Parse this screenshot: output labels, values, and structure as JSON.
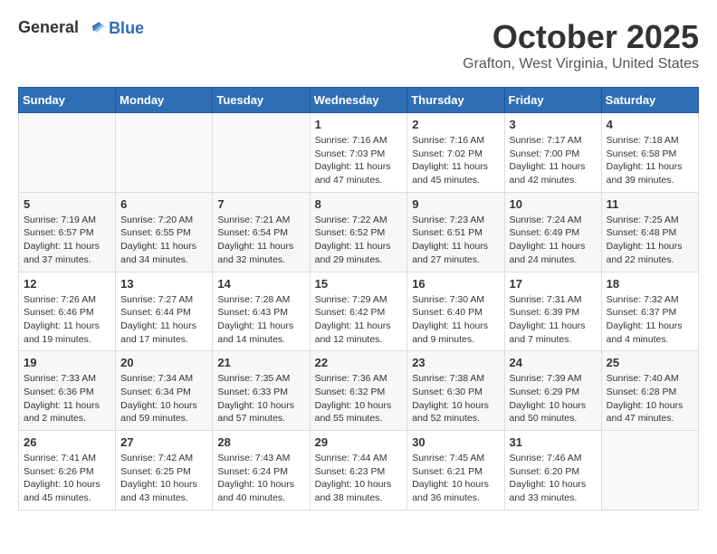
{
  "header": {
    "logo_line1": "General",
    "logo_line2": "Blue",
    "month_title": "October 2025",
    "location": "Grafton, West Virginia, United States"
  },
  "days_of_week": [
    "Sunday",
    "Monday",
    "Tuesday",
    "Wednesday",
    "Thursday",
    "Friday",
    "Saturday"
  ],
  "weeks": [
    [
      {
        "day": "",
        "info": ""
      },
      {
        "day": "",
        "info": ""
      },
      {
        "day": "",
        "info": ""
      },
      {
        "day": "1",
        "info": "Sunrise: 7:16 AM\nSunset: 7:03 PM\nDaylight: 11 hours and 47 minutes."
      },
      {
        "day": "2",
        "info": "Sunrise: 7:16 AM\nSunset: 7:02 PM\nDaylight: 11 hours and 45 minutes."
      },
      {
        "day": "3",
        "info": "Sunrise: 7:17 AM\nSunset: 7:00 PM\nDaylight: 11 hours and 42 minutes."
      },
      {
        "day": "4",
        "info": "Sunrise: 7:18 AM\nSunset: 6:58 PM\nDaylight: 11 hours and 39 minutes."
      }
    ],
    [
      {
        "day": "5",
        "info": "Sunrise: 7:19 AM\nSunset: 6:57 PM\nDaylight: 11 hours and 37 minutes."
      },
      {
        "day": "6",
        "info": "Sunrise: 7:20 AM\nSunset: 6:55 PM\nDaylight: 11 hours and 34 minutes."
      },
      {
        "day": "7",
        "info": "Sunrise: 7:21 AM\nSunset: 6:54 PM\nDaylight: 11 hours and 32 minutes."
      },
      {
        "day": "8",
        "info": "Sunrise: 7:22 AM\nSunset: 6:52 PM\nDaylight: 11 hours and 29 minutes."
      },
      {
        "day": "9",
        "info": "Sunrise: 7:23 AM\nSunset: 6:51 PM\nDaylight: 11 hours and 27 minutes."
      },
      {
        "day": "10",
        "info": "Sunrise: 7:24 AM\nSunset: 6:49 PM\nDaylight: 11 hours and 24 minutes."
      },
      {
        "day": "11",
        "info": "Sunrise: 7:25 AM\nSunset: 6:48 PM\nDaylight: 11 hours and 22 minutes."
      }
    ],
    [
      {
        "day": "12",
        "info": "Sunrise: 7:26 AM\nSunset: 6:46 PM\nDaylight: 11 hours and 19 minutes."
      },
      {
        "day": "13",
        "info": "Sunrise: 7:27 AM\nSunset: 6:44 PM\nDaylight: 11 hours and 17 minutes."
      },
      {
        "day": "14",
        "info": "Sunrise: 7:28 AM\nSunset: 6:43 PM\nDaylight: 11 hours and 14 minutes."
      },
      {
        "day": "15",
        "info": "Sunrise: 7:29 AM\nSunset: 6:42 PM\nDaylight: 11 hours and 12 minutes."
      },
      {
        "day": "16",
        "info": "Sunrise: 7:30 AM\nSunset: 6:40 PM\nDaylight: 11 hours and 9 minutes."
      },
      {
        "day": "17",
        "info": "Sunrise: 7:31 AM\nSunset: 6:39 PM\nDaylight: 11 hours and 7 minutes."
      },
      {
        "day": "18",
        "info": "Sunrise: 7:32 AM\nSunset: 6:37 PM\nDaylight: 11 hours and 4 minutes."
      }
    ],
    [
      {
        "day": "19",
        "info": "Sunrise: 7:33 AM\nSunset: 6:36 PM\nDaylight: 11 hours and 2 minutes."
      },
      {
        "day": "20",
        "info": "Sunrise: 7:34 AM\nSunset: 6:34 PM\nDaylight: 10 hours and 59 minutes."
      },
      {
        "day": "21",
        "info": "Sunrise: 7:35 AM\nSunset: 6:33 PM\nDaylight: 10 hours and 57 minutes."
      },
      {
        "day": "22",
        "info": "Sunrise: 7:36 AM\nSunset: 6:32 PM\nDaylight: 10 hours and 55 minutes."
      },
      {
        "day": "23",
        "info": "Sunrise: 7:38 AM\nSunset: 6:30 PM\nDaylight: 10 hours and 52 minutes."
      },
      {
        "day": "24",
        "info": "Sunrise: 7:39 AM\nSunset: 6:29 PM\nDaylight: 10 hours and 50 minutes."
      },
      {
        "day": "25",
        "info": "Sunrise: 7:40 AM\nSunset: 6:28 PM\nDaylight: 10 hours and 47 minutes."
      }
    ],
    [
      {
        "day": "26",
        "info": "Sunrise: 7:41 AM\nSunset: 6:26 PM\nDaylight: 10 hours and 45 minutes."
      },
      {
        "day": "27",
        "info": "Sunrise: 7:42 AM\nSunset: 6:25 PM\nDaylight: 10 hours and 43 minutes."
      },
      {
        "day": "28",
        "info": "Sunrise: 7:43 AM\nSunset: 6:24 PM\nDaylight: 10 hours and 40 minutes."
      },
      {
        "day": "29",
        "info": "Sunrise: 7:44 AM\nSunset: 6:23 PM\nDaylight: 10 hours and 38 minutes."
      },
      {
        "day": "30",
        "info": "Sunrise: 7:45 AM\nSunset: 6:21 PM\nDaylight: 10 hours and 36 minutes."
      },
      {
        "day": "31",
        "info": "Sunrise: 7:46 AM\nSunset: 6:20 PM\nDaylight: 10 hours and 33 minutes."
      },
      {
        "day": "",
        "info": ""
      }
    ]
  ]
}
